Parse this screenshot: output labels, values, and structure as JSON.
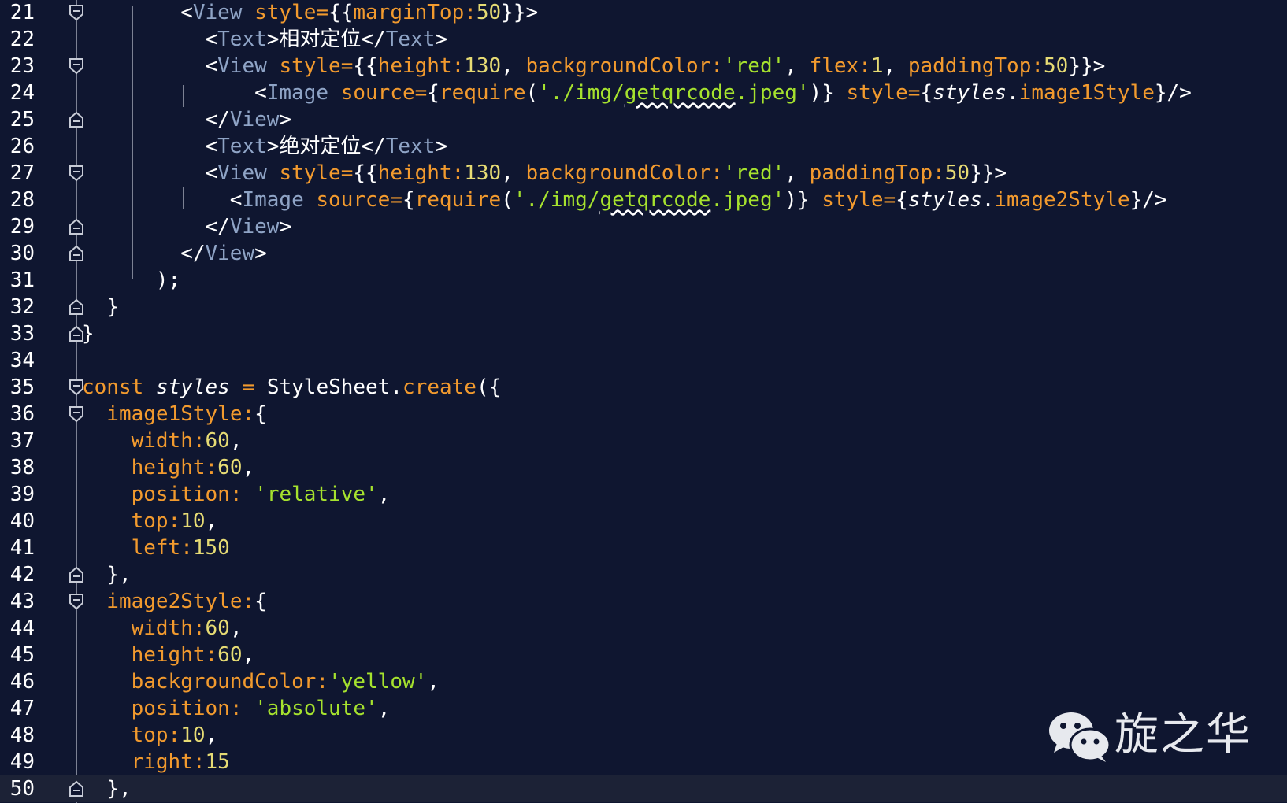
{
  "editor": {
    "lines": [
      {
        "number": "21",
        "fold": "open",
        "tokens": [
          {
            "t": "<",
            "c": "text"
          },
          {
            "t": "View",
            "c": "tag"
          },
          {
            "t": " ",
            "c": "text"
          },
          {
            "t": "style=",
            "c": "attr"
          },
          {
            "t": "{{",
            "c": "text"
          },
          {
            "t": "marginTop:",
            "c": "attr"
          },
          {
            "t": "50",
            "c": "num"
          },
          {
            "t": "}}>",
            "c": "text"
          }
        ]
      },
      {
        "number": "22",
        "fold": "none",
        "tokens": [
          {
            "t": "<",
            "c": "text"
          },
          {
            "t": "Text",
            "c": "tag"
          },
          {
            "t": ">相对定位</",
            "c": "text"
          },
          {
            "t": "Text",
            "c": "tag"
          },
          {
            "t": ">",
            "c": "text"
          }
        ]
      },
      {
        "number": "23",
        "fold": "open",
        "tokens": [
          {
            "t": "<",
            "c": "text"
          },
          {
            "t": "View",
            "c": "tag"
          },
          {
            "t": " ",
            "c": "text"
          },
          {
            "t": "style=",
            "c": "attr"
          },
          {
            "t": "{{",
            "c": "text"
          },
          {
            "t": "height:",
            "c": "attr"
          },
          {
            "t": "130",
            "c": "num"
          },
          {
            "t": ", ",
            "c": "text"
          },
          {
            "t": "backgroundColor:",
            "c": "attr"
          },
          {
            "t": "'red'",
            "c": "str"
          },
          {
            "t": ", ",
            "c": "text"
          },
          {
            "t": "flex:",
            "c": "attr"
          },
          {
            "t": "1",
            "c": "num"
          },
          {
            "t": ", ",
            "c": "text"
          },
          {
            "t": "paddingTop:",
            "c": "attr"
          },
          {
            "t": "50",
            "c": "num"
          },
          {
            "t": "}}>",
            "c": "text"
          }
        ]
      },
      {
        "number": "24",
        "fold": "none",
        "tokens": [
          {
            "t": "<",
            "c": "text"
          },
          {
            "t": "Image",
            "c": "tag"
          },
          {
            "t": " ",
            "c": "text"
          },
          {
            "t": "source=",
            "c": "attr"
          },
          {
            "t": "{",
            "c": "text"
          },
          {
            "t": "require",
            "c": "attr"
          },
          {
            "t": "(",
            "c": "text"
          },
          {
            "t": "'./img/",
            "c": "str"
          },
          {
            "t": "getqrcode",
            "c": "strsq"
          },
          {
            "t": ".jpeg'",
            "c": "str"
          },
          {
            "t": ")} ",
            "c": "text"
          },
          {
            "t": "style=",
            "c": "attr"
          },
          {
            "t": "{",
            "c": "text"
          },
          {
            "t": "styles",
            "c": "var"
          },
          {
            "t": ".",
            "c": "text"
          },
          {
            "t": "image1Style",
            "c": "attr"
          },
          {
            "t": "}/>",
            "c": "text"
          }
        ]
      },
      {
        "number": "25",
        "fold": "close",
        "tokens": [
          {
            "t": "</",
            "c": "text"
          },
          {
            "t": "View",
            "c": "tag"
          },
          {
            "t": ">",
            "c": "text"
          }
        ]
      },
      {
        "number": "26",
        "fold": "none",
        "tokens": [
          {
            "t": "<",
            "c": "text"
          },
          {
            "t": "Text",
            "c": "tag"
          },
          {
            "t": ">绝对定位</",
            "c": "text"
          },
          {
            "t": "Text",
            "c": "tag"
          },
          {
            "t": ">",
            "c": "text"
          }
        ]
      },
      {
        "number": "27",
        "fold": "open",
        "tokens": [
          {
            "t": "<",
            "c": "text"
          },
          {
            "t": "View",
            "c": "tag"
          },
          {
            "t": " ",
            "c": "text"
          },
          {
            "t": "style=",
            "c": "attr"
          },
          {
            "t": "{{",
            "c": "text"
          },
          {
            "t": "height:",
            "c": "attr"
          },
          {
            "t": "130",
            "c": "num"
          },
          {
            "t": ", ",
            "c": "text"
          },
          {
            "t": "backgroundColor:",
            "c": "attr"
          },
          {
            "t": "'red'",
            "c": "str"
          },
          {
            "t": ", ",
            "c": "text"
          },
          {
            "t": "paddingTop:",
            "c": "attr"
          },
          {
            "t": "50",
            "c": "num"
          },
          {
            "t": "}}>",
            "c": "text"
          }
        ]
      },
      {
        "number": "28",
        "fold": "none",
        "tokens": [
          {
            "t": "<",
            "c": "text"
          },
          {
            "t": "Image",
            "c": "tag"
          },
          {
            "t": " ",
            "c": "text"
          },
          {
            "t": "source=",
            "c": "attr"
          },
          {
            "t": "{",
            "c": "text"
          },
          {
            "t": "require",
            "c": "attr"
          },
          {
            "t": "(",
            "c": "text"
          },
          {
            "t": "'./img/",
            "c": "str"
          },
          {
            "t": "getqrcode",
            "c": "strsq"
          },
          {
            "t": ".jpeg'",
            "c": "str"
          },
          {
            "t": ")} ",
            "c": "text"
          },
          {
            "t": "style=",
            "c": "attr"
          },
          {
            "t": "{",
            "c": "text"
          },
          {
            "t": "styles",
            "c": "var"
          },
          {
            "t": ".",
            "c": "text"
          },
          {
            "t": "image2Style",
            "c": "attr"
          },
          {
            "t": "}/>",
            "c": "text"
          }
        ]
      },
      {
        "number": "29",
        "fold": "close",
        "tokens": [
          {
            "t": "</",
            "c": "text"
          },
          {
            "t": "View",
            "c": "tag"
          },
          {
            "t": ">",
            "c": "text"
          }
        ]
      },
      {
        "number": "30",
        "fold": "close",
        "tokens": [
          {
            "t": "</",
            "c": "text"
          },
          {
            "t": "View",
            "c": "tag"
          },
          {
            "t": ">",
            "c": "text"
          }
        ]
      },
      {
        "number": "31",
        "fold": "none",
        "tokens": [
          {
            "t": ");",
            "c": "text"
          }
        ]
      },
      {
        "number": "32",
        "fold": "close",
        "tokens": [
          {
            "t": "}",
            "c": "text"
          }
        ]
      },
      {
        "number": "33",
        "fold": "close",
        "tokens": [
          {
            "t": "}",
            "c": "text"
          }
        ]
      },
      {
        "number": "34",
        "fold": "none",
        "tokens": []
      },
      {
        "number": "35",
        "fold": "open",
        "tokens": [
          {
            "t": "const",
            "c": "attr"
          },
          {
            "t": " ",
            "c": "text"
          },
          {
            "t": "styles",
            "c": "var"
          },
          {
            "t": " ",
            "c": "text"
          },
          {
            "t": "=",
            "c": "attr"
          },
          {
            "t": " StyleSheet.",
            "c": "text"
          },
          {
            "t": "create",
            "c": "attr"
          },
          {
            "t": "({",
            "c": "text"
          }
        ]
      },
      {
        "number": "36",
        "fold": "open",
        "tokens": [
          {
            "t": "image1Style:",
            "c": "attr"
          },
          {
            "t": "{",
            "c": "text"
          }
        ]
      },
      {
        "number": "37",
        "fold": "none",
        "tokens": [
          {
            "t": "width:",
            "c": "attr"
          },
          {
            "t": "60",
            "c": "num"
          },
          {
            "t": ",",
            "c": "text"
          }
        ]
      },
      {
        "number": "38",
        "fold": "none",
        "tokens": [
          {
            "t": "height:",
            "c": "attr"
          },
          {
            "t": "60",
            "c": "num"
          },
          {
            "t": ",",
            "c": "text"
          }
        ]
      },
      {
        "number": "39",
        "fold": "none",
        "tokens": [
          {
            "t": "position: ",
            "c": "attr"
          },
          {
            "t": "'relative'",
            "c": "str"
          },
          {
            "t": ",",
            "c": "text"
          }
        ]
      },
      {
        "number": "40",
        "fold": "none",
        "tokens": [
          {
            "t": "top:",
            "c": "attr"
          },
          {
            "t": "10",
            "c": "num"
          },
          {
            "t": ",",
            "c": "text"
          }
        ]
      },
      {
        "number": "41",
        "fold": "none",
        "tokens": [
          {
            "t": "left:",
            "c": "attr"
          },
          {
            "t": "150",
            "c": "num"
          }
        ]
      },
      {
        "number": "42",
        "fold": "close",
        "tokens": [
          {
            "t": "},",
            "c": "text"
          }
        ]
      },
      {
        "number": "43",
        "fold": "open",
        "tokens": [
          {
            "t": "image2Style:",
            "c": "attr"
          },
          {
            "t": "{",
            "c": "text"
          }
        ]
      },
      {
        "number": "44",
        "fold": "none",
        "tokens": [
          {
            "t": "width:",
            "c": "attr"
          },
          {
            "t": "60",
            "c": "num"
          },
          {
            "t": ",",
            "c": "text"
          }
        ]
      },
      {
        "number": "45",
        "fold": "none",
        "tokens": [
          {
            "t": "height:",
            "c": "attr"
          },
          {
            "t": "60",
            "c": "num"
          },
          {
            "t": ",",
            "c": "text"
          }
        ]
      },
      {
        "number": "46",
        "fold": "none",
        "tokens": [
          {
            "t": "backgroundColor:",
            "c": "attr"
          },
          {
            "t": "'yellow'",
            "c": "str"
          },
          {
            "t": ",",
            "c": "text"
          }
        ]
      },
      {
        "number": "47",
        "fold": "none",
        "tokens": [
          {
            "t": "position: ",
            "c": "attr"
          },
          {
            "t": "'absolute'",
            "c": "str"
          },
          {
            "t": ",",
            "c": "text"
          }
        ]
      },
      {
        "number": "48",
        "fold": "none",
        "tokens": [
          {
            "t": "top:",
            "c": "attr"
          },
          {
            "t": "10",
            "c": "num"
          },
          {
            "t": ",",
            "c": "text"
          }
        ]
      },
      {
        "number": "49",
        "fold": "none",
        "tokens": [
          {
            "t": "right:",
            "c": "attr"
          },
          {
            "t": "15",
            "c": "num"
          }
        ]
      },
      {
        "number": "50",
        "fold": "close",
        "current": true,
        "tokens": [
          {
            "t": "},",
            "c": "text"
          }
        ]
      }
    ]
  },
  "watermark": {
    "icon": "wechat-icon",
    "text": "旋之华"
  },
  "colors": {
    "background": "#0f1630",
    "current_line": "#1c2236",
    "tag": "#8fa4c6",
    "attr": "#f29a2e",
    "number": "#e6db74",
    "string": "#a6e22e",
    "text": "#ffffff"
  }
}
